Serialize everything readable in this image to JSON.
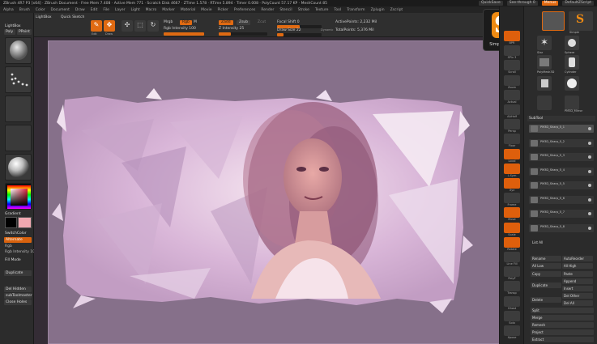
{
  "titlebar": {
    "info": "ZBrush 4R7 P3 [x64]  ·  ZBrush Document  ·  Free Mem 7.408 · Active Mem 771 · Scratch Disk 4667 · ZTime 1.578 · RTime 5.894 · Timer 0.008 · PolyCount 57.17 KP · MeshCount 85",
    "quicksave": "QuickSave",
    "seethrough": "See-through  0",
    "menus": "Menus",
    "default_script": "DefaultZScript"
  },
  "menubar": [
    "Alpha",
    "Brush",
    "Color",
    "Document",
    "Draw",
    "Edit",
    "File",
    "Layer",
    "Light",
    "Macro",
    "Marker",
    "Material",
    "Movie",
    "Picker",
    "Preferences",
    "Render",
    "Stencil",
    "Stroke",
    "Texture",
    "Tool",
    "Transform",
    "Zplugin",
    "Zscript"
  ],
  "left": {
    "lightbox": "LightBox",
    "gradient": "Gradient",
    "switchcolor": "SwitchColor",
    "alternate": "Alternate",
    "rgb": "Rgb",
    "rgb_intensity": "Rgb Intensity 100",
    "fill": "Fill  Mode",
    "dup": "Duplicate",
    "del_hidden": "Del Hidden",
    "subtool_ops": "subToolmaster",
    "close_holes": "Close Holes",
    "poly": "Poly",
    "ppoint": "PPoint"
  },
  "toolbar": {
    "lightbox": "LightBox",
    "quick_sketch": "Quick Sketch",
    "edit": "Edit",
    "draw": "Draw",
    "move": "Move",
    "scale": "Scale",
    "rotate": "Rotate",
    "mrgb": "Mrgb",
    "rgb": "Rgb",
    "m": "M",
    "rgb_intensity": "Rgb Intensity 100",
    "zadd": "Zadd",
    "zsub": "Zsub",
    "zcut": "Zcut",
    "z_intensity": "Z Intensity 25",
    "focal_shift": "Focal Shift 0",
    "draw_size": "Draw Size 22",
    "dynamic": "Dynamic",
    "active_points": "ActivePoints: 2,232  Mil",
    "total_points": "TotalPoints: 5,376  Mil",
    "rgb_slider_fraction": 1.0,
    "z_slider_fraction": 0.25,
    "focal_slider_fraction": 0.5,
    "size_slider_fraction": 0.15
  },
  "logo": {
    "letter": "S",
    "label": "SimpleBrush"
  },
  "midstrip": [
    "BPR",
    "SPix 3",
    "Scroll",
    "Zoom",
    "Actual",
    "AAHalf",
    "Persp",
    "Floor",
    "Local",
    "L.Sym",
    "Xyz",
    "Frame",
    "Move",
    "Scale",
    "Rotate",
    "Line Fill",
    "PolyF",
    "Transp",
    "Ghost",
    "Solo",
    "Xpose"
  ],
  "right": {
    "tools": [
      "Simple",
      "Star",
      "PolyMesh3D",
      "Cylinder",
      "SimpleBrush",
      "Sphere",
      "PM3D_Mirror"
    ],
    "subtool_title": "SubTool",
    "subtools": [
      "PM3D_Sharp_5_1",
      "PM3D_Sharp_5_2",
      "PM3D_Sharp_5_3",
      "PM3D_Sharp_5_4",
      "PM3D_Sharp_5_5",
      "PM3D_Sharp_5_6",
      "PM3D_Sharp_5_7",
      "PM3D_Sharp_5_8"
    ],
    "list_all": "List All",
    "rename": "Rename",
    "autoreorder": "AutoReorder",
    "all_low": "All Low",
    "all_high": "All High",
    "copy": "Copy",
    "paste": "Paste",
    "append": "Append",
    "duplicate": "Duplicate",
    "insert": "Insert",
    "del_other": "Del Other",
    "delete": "Delete",
    "del_all": "Del All",
    "split": "Split",
    "merge": "Merge",
    "remesh": "Remesh",
    "project": "Project",
    "extract": "Extract"
  },
  "colors": {
    "accent": "#e06a12",
    "canvas_bg": "#86708a",
    "primary_color": "#f0a8b0"
  }
}
